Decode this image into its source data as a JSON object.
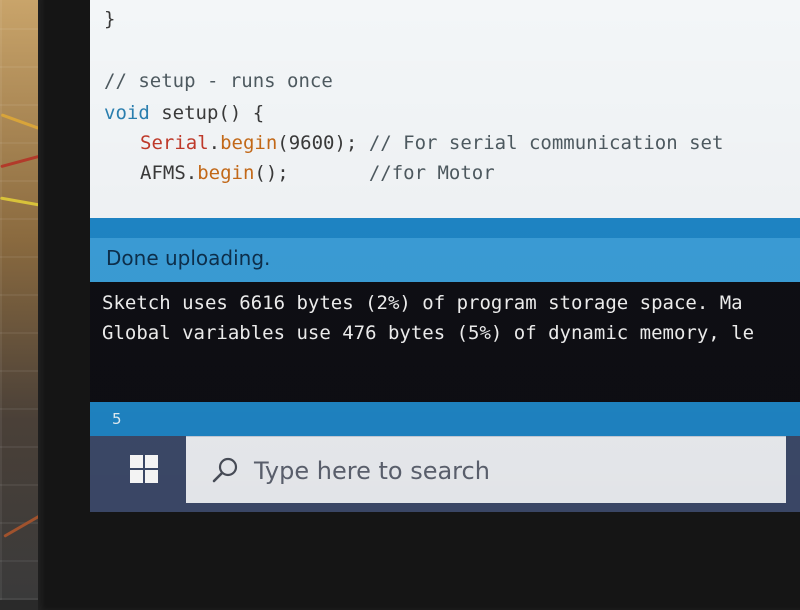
{
  "editor": {
    "lines": [
      {
        "text": "}"
      },
      {
        "text": ""
      },
      {
        "comment": "// setup - runs once"
      },
      {
        "kw": "void",
        "rest": " setup() {"
      },
      {
        "obj": "Serial",
        "dot": ".",
        "fn": "begin",
        "rest": "(9600); ",
        "comment": "// For serial communication set"
      },
      {
        "rest": "AFMS.",
        "fn": "begin",
        "rest2": "();",
        "pad": "       ",
        "comment": "//for Motor"
      }
    ]
  },
  "status": {
    "text": "Done uploading."
  },
  "console": {
    "lines": [
      "Sketch uses 6616 bytes (2%) of program storage space. Ma",
      "Global variables use 476 bytes (5%) of dynamic memory, le"
    ]
  },
  "footer": {
    "line_number": "5"
  },
  "taskbar": {
    "start_icon": "windows-logo-icon",
    "search_icon": "search-icon",
    "search_placeholder": "Type here to search"
  },
  "colors": {
    "accent": "#1f86c6",
    "console_bg": "#0e0e14",
    "keyword": "#2a7fb0",
    "function": "#c56a18",
    "object": "#c13a2a"
  }
}
